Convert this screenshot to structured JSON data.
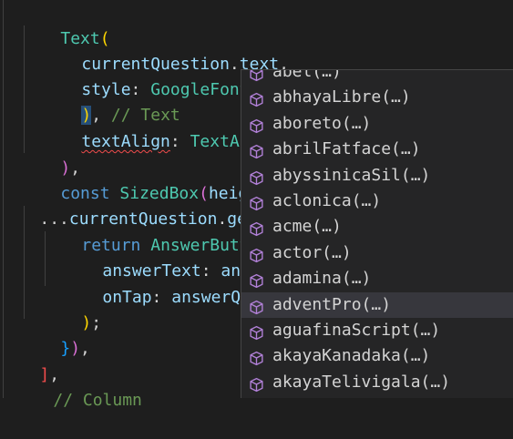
{
  "code": {
    "line1": {
      "a": "Text",
      "b": "("
    },
    "line2": {
      "a": "currentQuestion",
      "b": ".",
      "c": "text",
      "d": ","
    },
    "line3": {
      "a": "style",
      "b": ": ",
      "c": "GoogleFonts",
      "d": ".",
      "e": "."
    },
    "line4": {
      "a": ")",
      "b": ", ",
      "c": "// Text"
    },
    "line5": {
      "a": "textAlign",
      "b": ": ",
      "c": "TextAlig"
    },
    "line6": {
      "a": ")",
      "b": ","
    },
    "line7": {
      "a": "const",
      "b": " ",
      "c": "SizedBox",
      "d": "(",
      "e": "height"
    },
    "line8": {
      "a": "...",
      "b": "currentQuestion",
      "c": ".",
      "d": "ge"
    },
    "line9": {
      "a": "return",
      "b": " ",
      "c": "AnswerButton"
    },
    "line10": {
      "a": "answerText",
      "b": ": ",
      "c": "answe"
    },
    "line11": {
      "a": "onTap",
      "b": ": ",
      "c": "answerQues"
    },
    "line12": {
      "a": ")",
      "b": ";"
    },
    "line13": {
      "a": "}",
      "b": ")",
      "c": ","
    },
    "line14": {
      "a": "]",
      "b": ","
    },
    "line15": {
      "a": "// Column"
    }
  },
  "suggestions": {
    "icon": "cube-method-icon",
    "items": [
      {
        "label": "abel(…)"
      },
      {
        "label": "abhayaLibre(…)"
      },
      {
        "label": "aboreto(…)"
      },
      {
        "label": "abrilFatface(…)"
      },
      {
        "label": "abyssinicaSil(…)"
      },
      {
        "label": "aclonica(…)"
      },
      {
        "label": "acme(…)"
      },
      {
        "label": "actor(…)"
      },
      {
        "label": "adamina(…)"
      },
      {
        "label": "adventPro(…)"
      },
      {
        "label": "aguafinaScript(…)"
      },
      {
        "label": "akayaKanadaka(…)"
      },
      {
        "label": "akayaTelivigala(…)"
      }
    ],
    "active_index": 9
  },
  "colors": {
    "background": "#1e1e1e",
    "widget": "#252526",
    "active_row": "#37373d",
    "method_icon": "#b180d7"
  }
}
